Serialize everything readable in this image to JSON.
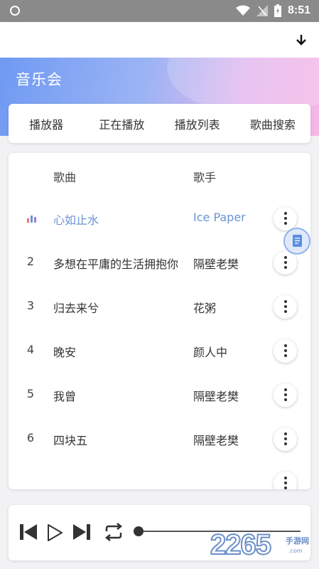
{
  "status_bar": {
    "time": "8:51"
  },
  "header": {
    "app_title": "音乐会"
  },
  "tabs": [
    {
      "label": "播放器"
    },
    {
      "label": "正在播放"
    },
    {
      "label": "播放列表"
    },
    {
      "label": "歌曲搜索"
    }
  ],
  "song_list": {
    "columns": {
      "song": "歌曲",
      "artist": "歌手"
    },
    "rows": [
      {
        "index": "",
        "title": "心如止水",
        "artist": "Ice Paper",
        "playing": true
      },
      {
        "index": "2",
        "title": "多想在平庸的生活拥抱你",
        "artist": "隔壁老樊",
        "playing": false
      },
      {
        "index": "3",
        "title": "归去来兮",
        "artist": "花粥",
        "playing": false
      },
      {
        "index": "4",
        "title": "晚安",
        "artist": "颜人中",
        "playing": false
      },
      {
        "index": "5",
        "title": "我曾",
        "artist": "隔壁老樊",
        "playing": false
      },
      {
        "index": "6",
        "title": "四块五",
        "artist": "隔壁老樊",
        "playing": false
      }
    ]
  },
  "player": {
    "progress": 0
  },
  "watermark": {
    "number": "2265",
    "suffix": ".com",
    "text": "手游网"
  },
  "colors": {
    "accent": "#6a93d6",
    "banner_start": "#6f9af3",
    "banner_end": "#f5b7e6"
  },
  "icons": [
    "shield-icon",
    "wifi-icon",
    "signal-icon",
    "battery-icon",
    "download-icon",
    "equalizer-icon",
    "more-vertical-icon",
    "document-icon",
    "skip-previous-icon",
    "play-icon",
    "skip-next-icon",
    "repeat-icon"
  ]
}
